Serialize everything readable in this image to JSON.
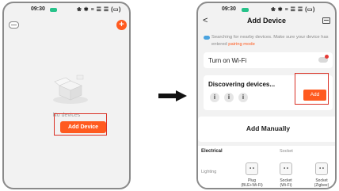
{
  "left_phone": {
    "status": {
      "time": "09:30",
      "icons": "❀ ✱ ≡ ☰ ☰ (▭)"
    },
    "empty_text": "No devices",
    "add_device_button": "Add Device"
  },
  "right_phone": {
    "status": {
      "time": "09:30",
      "icons": "❀ ✱ ≡ ☰ ☰ (▭)"
    },
    "header": {
      "back": "<",
      "title": "Add Device"
    },
    "search_notice": {
      "text": "Searching for nearby devices. Make sure your device has entered ",
      "link": "pairing mode"
    },
    "wifi": {
      "label": "Turn on Wi-Fi"
    },
    "discover": {
      "label": "Discovering devices...",
      "device_glyph": "i",
      "add_button": "Add"
    },
    "manual": {
      "label": "Add Manually"
    },
    "categories": {
      "electrical": "Electrical",
      "socket_header": "Socket",
      "lighting": "Lighting"
    },
    "products": [
      {
        "glyph": "• •",
        "label_line1": "Plug",
        "label_line2": "(BLE+Wi-Fi)"
      },
      {
        "glyph": "• •",
        "label_line1": "Socket",
        "label_line2": "(Wi-Fi)"
      },
      {
        "glyph": "• •",
        "label_line1": "Socket",
        "label_line2": "(Zigbee)"
      }
    ]
  },
  "colors": {
    "accent": "#ff5a1f",
    "highlight": "#d93025",
    "status_green": "#27c28a"
  }
}
